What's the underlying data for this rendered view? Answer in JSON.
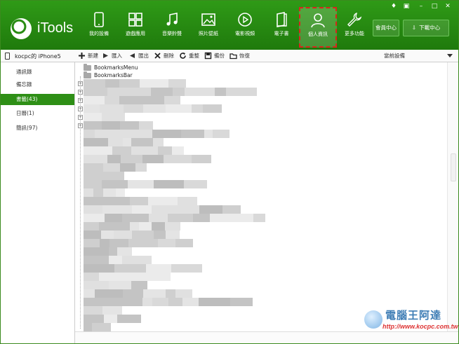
{
  "app": {
    "title": "iTools"
  },
  "nav": [
    {
      "label": "我的設備",
      "icon": "phone-icon"
    },
    {
      "label": "遊戲應用",
      "icon": "apps-grid-icon"
    },
    {
      "label": "音樂鈴聲",
      "icon": "music-note-icon"
    },
    {
      "label": "照片壁紙",
      "icon": "picture-icon"
    },
    {
      "label": "電影視頻",
      "icon": "play-icon"
    },
    {
      "label": "電子書",
      "icon": "book-icon"
    },
    {
      "label": "個人資訊",
      "icon": "person-icon",
      "active": true
    },
    {
      "label": "更多功能",
      "icon": "wrench-icon"
    }
  ],
  "header_buttons": {
    "member": "會員中心",
    "download": "下載中心"
  },
  "device": {
    "name": "kocpc的 iPhone5"
  },
  "sidebar": {
    "items": [
      {
        "label": "通訊錄"
      },
      {
        "label": "備忘錄"
      },
      {
        "label": "書籤(43)",
        "active": true
      },
      {
        "label": "日曆(1)"
      },
      {
        "label": "簡訊(97)"
      }
    ]
  },
  "toolbar": {
    "new": "新建",
    "import": "匯入",
    "export": "匯出",
    "delete": "刪除",
    "refresh": "重整",
    "backup": "備份",
    "restore": "恢復",
    "device_select": "當前設備"
  },
  "tree": {
    "folders": [
      "BookmarksMenu",
      "BookmarksBar"
    ]
  },
  "watermark": {
    "title": "電腦王阿達",
    "url": "http://www.kocpc.com.tw"
  },
  "colors": {
    "brand_green": "#2e8f16",
    "highlight_border": "#d9261c"
  }
}
